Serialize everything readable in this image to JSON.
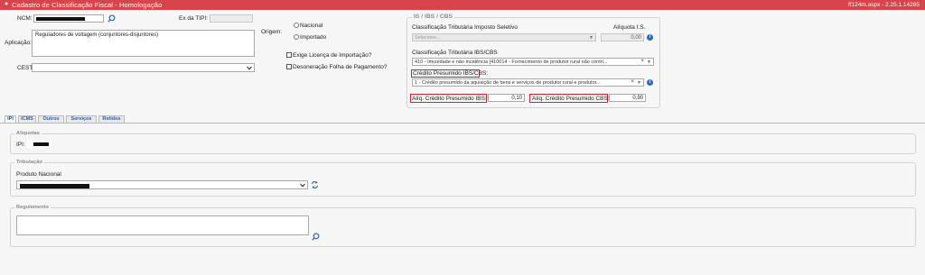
{
  "titlebar": {
    "title": "Cadastro de Classificação Fiscal - Homologação",
    "version": "ff124m.aspx - 2.25.1.14265"
  },
  "form": {
    "ncm_label": "NCM:",
    "ex_tipi_label": "Ex da TIPI:",
    "aplicacao_label": "Aplicação:",
    "aplicacao_value": "Reguladores de voltagem (conjuntores-disjuntores)",
    "cest_label": "CEST:",
    "origem_label": "Origem:",
    "origem_options": [
      "Nacional",
      "Importado"
    ],
    "exige_licenca_label": "Exige Licença de Importação?",
    "desoneracao_label": "Desoneração Folha de Pagamento?"
  },
  "is_ibs_cbs": {
    "legend": "IS / IBS / CBS",
    "class_is_label": "Classificação Tributária Imposto Seletivo",
    "class_is_placeholder": "Selecione...",
    "aliquota_is_label": "Alíquota I.S.",
    "aliquota_is_value": "0,00",
    "class_ibs_cbs_label": "Classificação Tributária IBS/CBS",
    "class_ibs_cbs_value": "410 - Imunidade e não incidência [410014 - Fornecimento de produtor rural não contri...",
    "credito_label": "Crédito Presumido IBS/CBS:",
    "credito_value": "1 - Crédito presumido da aquisição de bens e serviços de produtor rural e produtor...",
    "aliq_credito_ibs_label": "Alíq. Crédito Presumido IBS:",
    "aliq_credito_ibs_value": "0,10",
    "aliq_credito_cbs_label": "Alíq. Crédito Presumido CBS:",
    "aliq_credito_cbs_value": "0,90"
  },
  "tabs": [
    "IPI",
    "ICMS",
    "Outros",
    "Serviços",
    "Retidos"
  ],
  "ipi": {
    "aliquotas_title": "Alíquotas",
    "ipi_label": "IPI:",
    "tributacao_title": "Tributação",
    "produto_label": "Produto Nacional",
    "regulamento_title": "Regulamento"
  },
  "icons": {
    "bell": "bell-icon",
    "search": "search-icon",
    "refresh": "refresh-icon",
    "info": "info-icon"
  },
  "colors": {
    "titlebar": "#d9434a",
    "highlight": "#c8262e",
    "tab_text": "#2e5aa6",
    "info": "#2c6bb3"
  }
}
